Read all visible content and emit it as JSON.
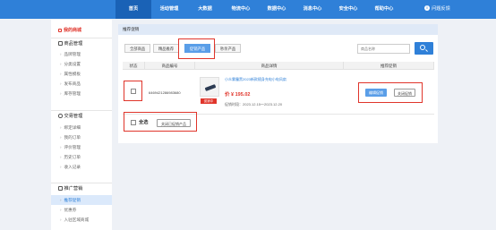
{
  "topnav": {
    "items": [
      {
        "label": "首页",
        "active": true
      },
      {
        "label": "活动管理",
        "active": false
      },
      {
        "label": "大数据",
        "active": false
      },
      {
        "label": "物流中心",
        "active": false
      },
      {
        "label": "数据中心",
        "active": false
      },
      {
        "label": "消息中心",
        "active": false
      },
      {
        "label": "安全中心",
        "active": false
      },
      {
        "label": "帮助中心",
        "active": false
      }
    ],
    "help_label": "问题反馈"
  },
  "sidebar": {
    "home": "我的商城",
    "groups": [
      {
        "label": "商品管理",
        "items": [
          "品牌管理",
          "分类设置",
          "属性模板",
          "发布商品",
          "库存管理"
        ]
      },
      {
        "label": "交易管理",
        "items": [
          "绑定详细",
          "我的订单",
          "评价管理",
          "历史订单",
          "收入记录"
        ]
      },
      {
        "label": "推广营销",
        "items": [
          "推荐促销",
          "优惠券",
          "入驻区域商城"
        ]
      }
    ],
    "active_item": "推荐促销"
  },
  "breadcrumb": "推荐促销",
  "tabs": [
    {
      "label": "全部商品",
      "active": false
    },
    {
      "label": "精品推荐",
      "active": false
    },
    {
      "label": "促销产品",
      "active": true
    },
    {
      "label": "秒杀产品",
      "active": false
    }
  ],
  "search": {
    "placeholder": "商品名称"
  },
  "table": {
    "headers": [
      "状态",
      "商品编号",
      "商品详情",
      "推荐促销"
    ],
    "rows": [
      {
        "code": "6469421286983680",
        "name": "小众雾霾黑2023新款随身充电小电风扇",
        "price": "价 ¥ 195.02",
        "tag": "促销中",
        "period": "促销时段：2023.12.15～2023.12.20",
        "actions": [
          "编辑促销",
          "关闭促销"
        ]
      }
    ]
  },
  "footer": {
    "select_all": "全选",
    "batch_close": "关闭已促销产品"
  },
  "colors": {
    "primary": "#2f80d8",
    "highlight": "#e0352b",
    "sidebar_active": "#dbe9fb"
  }
}
